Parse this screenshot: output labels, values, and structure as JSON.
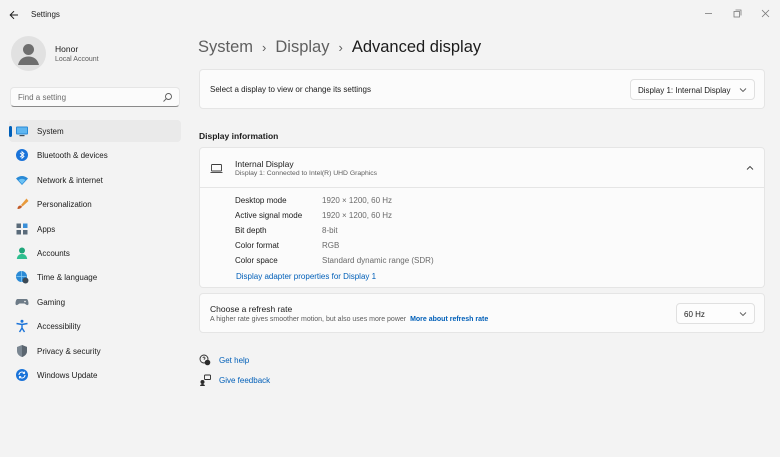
{
  "window": {
    "app_title": "Settings"
  },
  "user": {
    "name": "Honor",
    "account_type": "Local Account"
  },
  "search": {
    "placeholder": "Find a setting"
  },
  "sidebar": {
    "items": [
      {
        "label": "System",
        "icon": "monitor-icon",
        "active": true
      },
      {
        "label": "Bluetooth & devices",
        "icon": "bluetooth-icon"
      },
      {
        "label": "Network & internet",
        "icon": "wifi-icon"
      },
      {
        "label": "Personalization",
        "icon": "brush-icon"
      },
      {
        "label": "Apps",
        "icon": "apps-icon"
      },
      {
        "label": "Accounts",
        "icon": "person-icon"
      },
      {
        "label": "Time & language",
        "icon": "globe-clock-icon"
      },
      {
        "label": "Gaming",
        "icon": "gamepad-icon"
      },
      {
        "label": "Accessibility",
        "icon": "accessibility-icon"
      },
      {
        "label": "Privacy & security",
        "icon": "shield-icon"
      },
      {
        "label": "Windows Update",
        "icon": "update-icon"
      }
    ]
  },
  "breadcrumb": {
    "part1": "System",
    "part2": "Display",
    "current": "Advanced display",
    "separator": "›"
  },
  "display_select": {
    "label": "Select a display to view or change its settings",
    "value": "Display 1: Internal Display"
  },
  "display_info": {
    "section_title": "Display information",
    "name": "Internal Display",
    "subtitle": "Display 1: Connected to Intel(R) UHD Graphics",
    "properties": [
      {
        "key": "Desktop mode",
        "value": "1920 × 1200, 60 Hz"
      },
      {
        "key": "Active signal mode",
        "value": "1920 × 1200, 60 Hz"
      },
      {
        "key": "Bit depth",
        "value": "8-bit"
      },
      {
        "key": "Color format",
        "value": "RGB"
      },
      {
        "key": "Color space",
        "value": "Standard dynamic range (SDR)"
      }
    ],
    "adapter_link": "Display adapter properties for Display 1"
  },
  "refresh_rate": {
    "title": "Choose a refresh rate",
    "description": "A higher rate gives smoother motion, but also uses more power",
    "more_link": "More about refresh rate",
    "value": "60 Hz"
  },
  "help": {
    "get_help": "Get help",
    "give_feedback": "Give feedback"
  },
  "colors": {
    "accent": "#005fb8",
    "background": "#f3f3f3",
    "card": "#fbfbfb"
  }
}
